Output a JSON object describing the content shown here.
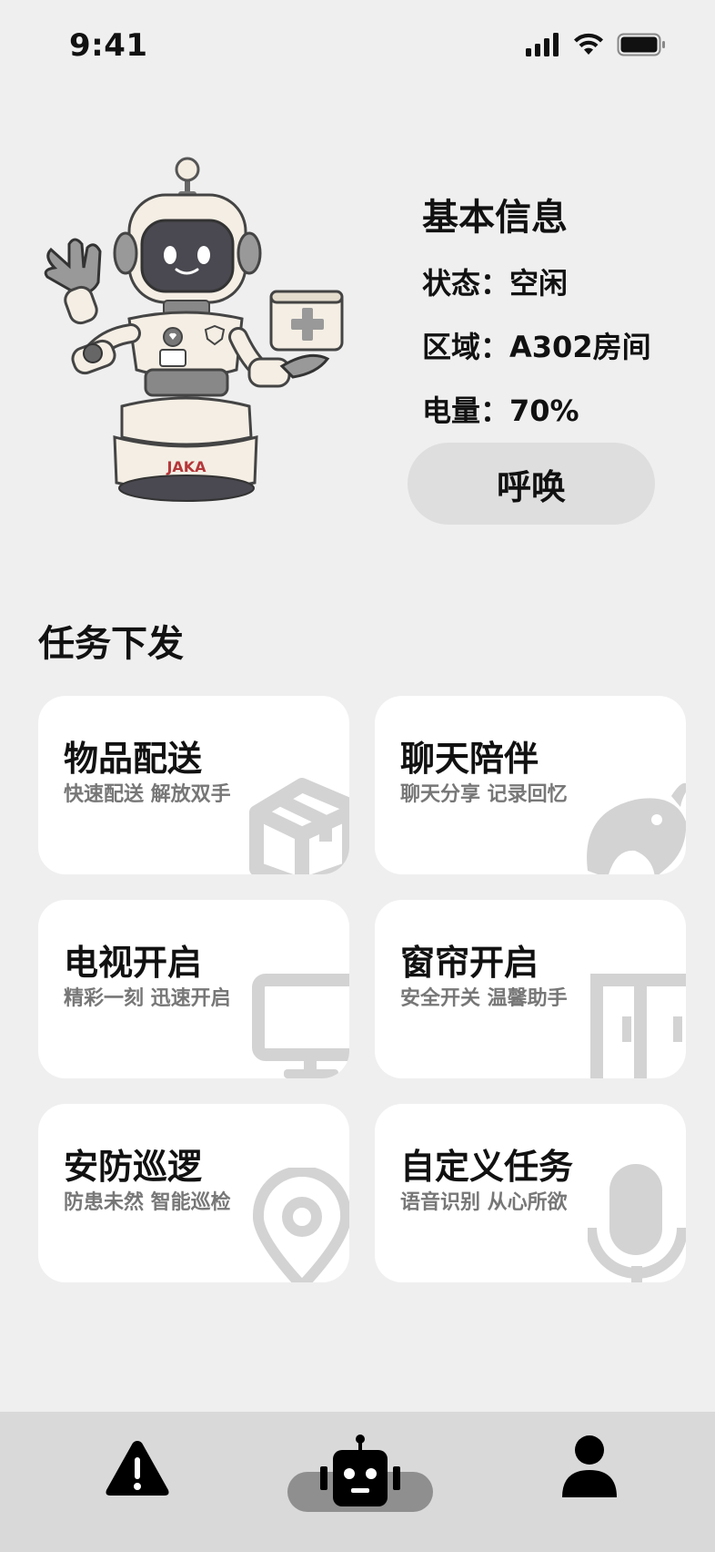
{
  "status_bar": {
    "time": "9:41",
    "icons": [
      "cellular-signal-icon",
      "wifi-icon",
      "battery-icon"
    ]
  },
  "robot": {
    "illustration": "robot-mascot",
    "brand_text": "JAKA"
  },
  "info": {
    "title": "基本信息",
    "status_label": "状态：",
    "status_value": "空闲",
    "area_label": "区域：",
    "area_value": "A302房间",
    "battery_label": "电量：",
    "battery_value": "70%",
    "call_button": "呼唤"
  },
  "tasks": {
    "section_title": "任务下发",
    "items": [
      {
        "title": "物品配送",
        "subtitle": "快速配送 解放双手",
        "icon": "box-icon"
      },
      {
        "title": "聊天陪伴",
        "subtitle": "聊天分享 记录回忆",
        "icon": "chat-companion-icon"
      },
      {
        "title": "电视开启",
        "subtitle": "精彩一刻 迅速开启",
        "icon": "tv-icon"
      },
      {
        "title": "窗帘开启",
        "subtitle": "安全开关 温馨助手",
        "icon": "curtain-icon"
      },
      {
        "title": "安防巡逻",
        "subtitle": "防患未然 智能巡检",
        "icon": "location-pin-icon"
      },
      {
        "title": "自定义任务",
        "subtitle": "语音识别 从心所欲",
        "icon": "microphone-icon"
      }
    ]
  },
  "tab_bar": {
    "items": [
      {
        "icon": "alert-icon",
        "active": false
      },
      {
        "icon": "robot-icon",
        "active": true
      },
      {
        "icon": "profile-icon",
        "active": false
      }
    ],
    "active_color": "#8f8f8f"
  },
  "colors": {
    "background": "#efefef",
    "card": "#ffffff",
    "button": "#dedede",
    "tab_bar": "#d9d9d9",
    "icon_gray": "#d3d3d3",
    "brand_red": "#b5373a"
  }
}
